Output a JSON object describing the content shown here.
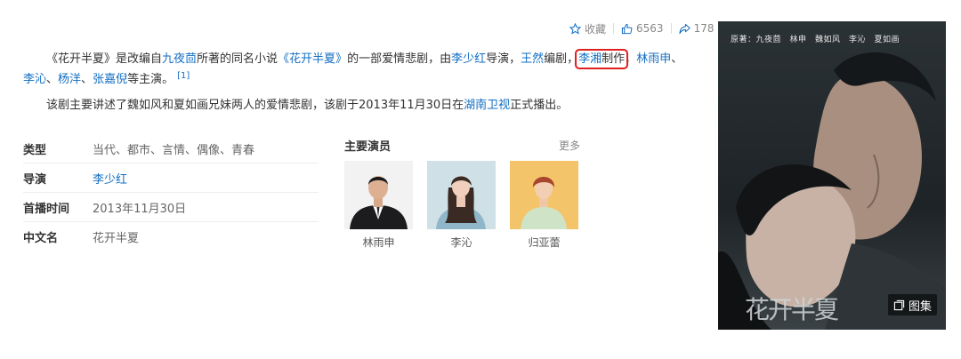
{
  "toolbar": {
    "favorite_label": "收藏",
    "likes": "6563",
    "shares": "178"
  },
  "intro": {
    "p1": [
      {
        "text": "《花开半夏》是改编自",
        "link": false
      },
      {
        "text": "九夜茴",
        "link": true
      },
      {
        "text": "所著的同名小说",
        "link": false
      },
      {
        "text": "《花开半夏》",
        "link": true
      },
      {
        "text": "的一部爱情悲剧，由",
        "link": false
      },
      {
        "text": "李少红",
        "link": true
      },
      {
        "text": "导演，",
        "link": false
      },
      {
        "text": "王然",
        "link": true
      },
      {
        "text": "编剧，",
        "link": false
      },
      {
        "text": "李湘",
        "link": true,
        "highlight_start": true
      },
      {
        "text": "制作",
        "link": false,
        "highlight_end": true
      },
      {
        "text": "，",
        "link": false
      },
      {
        "text": "林雨申",
        "link": true
      },
      {
        "text": "、",
        "link": false
      },
      {
        "text": "李沁",
        "link": true
      },
      {
        "text": "、",
        "link": false
      },
      {
        "text": "杨洋",
        "link": true
      },
      {
        "text": "、",
        "link": false
      },
      {
        "text": "张嘉倪",
        "link": true
      },
      {
        "text": "等主演。",
        "link": false
      }
    ],
    "p1_ref": "[1]",
    "p2": [
      {
        "text": "该剧主要讲述了魏如风和夏如画兄妹两人的爱情悲剧，该剧于2013年11月30日在",
        "link": false
      },
      {
        "text": "湖南卫视",
        "link": true
      },
      {
        "text": "正式播出。",
        "link": false
      }
    ]
  },
  "info": {
    "rows": [
      {
        "key": "类型",
        "value": "当代、都市、言情、偶像、青春",
        "link": false
      },
      {
        "key": "导演",
        "value": "李少红",
        "link": true
      },
      {
        "key": "首播时间",
        "value": "2013年11月30日",
        "link": false
      },
      {
        "key": "中文名",
        "value": "花开半夏",
        "link": false
      }
    ]
  },
  "cast": {
    "title": "主要演员",
    "more": "更多",
    "actors": [
      {
        "name": "林雨申"
      },
      {
        "name": "李沁"
      },
      {
        "name": "归亚蕾"
      }
    ]
  },
  "poster": {
    "credits": "原著：九夜茴　林申　魏如风　李沁　夏如画",
    "logo_text": "花开半夏",
    "gallery_label": "图集"
  },
  "colors": {
    "link": "#136ec2",
    "highlight_border": "#e02020"
  }
}
